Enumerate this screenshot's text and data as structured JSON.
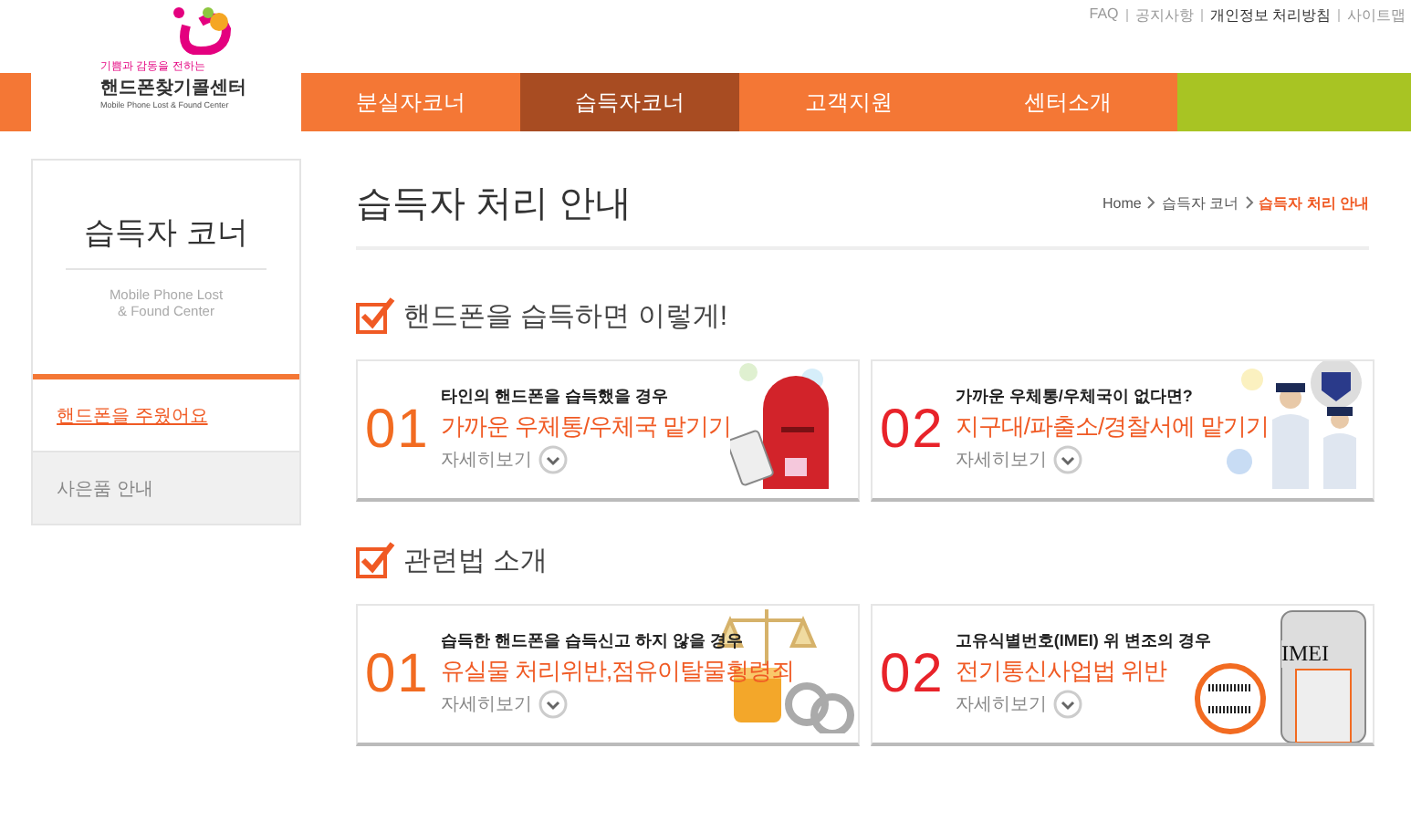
{
  "header": {
    "logo": {
      "tagline": "기쁨과 감동을 전하는",
      "name": "핸드폰찾기콜센터",
      "subtitle": "Mobile Phone Lost & Found Center"
    },
    "top_links": [
      {
        "label": "FAQ",
        "highlighted": false
      },
      {
        "label": "공지사항",
        "highlighted": false
      },
      {
        "label": "개인정보 처리방침",
        "highlighted": true
      },
      {
        "label": "사이트맵",
        "highlighted": false
      }
    ],
    "nav": [
      {
        "label": "분실자코너",
        "selected": false
      },
      {
        "label": "습득자코너",
        "selected": true
      },
      {
        "label": "고객지원",
        "selected": false
      },
      {
        "label": "센터소개",
        "selected": false
      }
    ]
  },
  "sidebar": {
    "title": "습득자 코너",
    "subtitle": "Mobile Phone Lost\n& Found Center",
    "items": [
      {
        "label": "핸드폰을 주웠어요",
        "selected": true
      },
      {
        "label": "사은품 안내",
        "selected": false
      }
    ]
  },
  "page": {
    "title": "습득자 처리 안내",
    "breadcrumb": [
      "Home",
      "습득자 코너",
      "습득자 처리 안내"
    ],
    "sections": [
      {
        "heading": "핸드폰을 습득하면 이렇게!",
        "cards": [
          {
            "number": "01",
            "subtitle": "타인의 핸드폰을 습득했을 경우",
            "title": "가까운 우체통/우체국 맡기기",
            "more": "자세히보기",
            "color": "#f26b21",
            "kind": "mailbox"
          },
          {
            "number": "02",
            "subtitle": "가까운 우체통/우체국이 없다면?",
            "title": "지구대/파출소/경찰서에 맡기기",
            "more": "자세히보기",
            "color": "#e8232a",
            "kind": "police"
          }
        ]
      },
      {
        "heading": "관련법 소개",
        "cards": [
          {
            "number": "01",
            "subtitle": "습득한 핸드폰을 습득신고 하지 않을 경우",
            "title": "유실물 처리위반,점유이탈물횡령죄",
            "more": "자세히보기",
            "color": "#f26b21",
            "kind": "scales"
          },
          {
            "number": "02",
            "subtitle": "고유식별번호(IMEI) 위 변조의 경우",
            "title": "전기통신사업법 위반",
            "more": "자세히보기",
            "color": "#e8232a",
            "kind": "imei",
            "image_label": "IMEI"
          }
        ]
      }
    ]
  }
}
